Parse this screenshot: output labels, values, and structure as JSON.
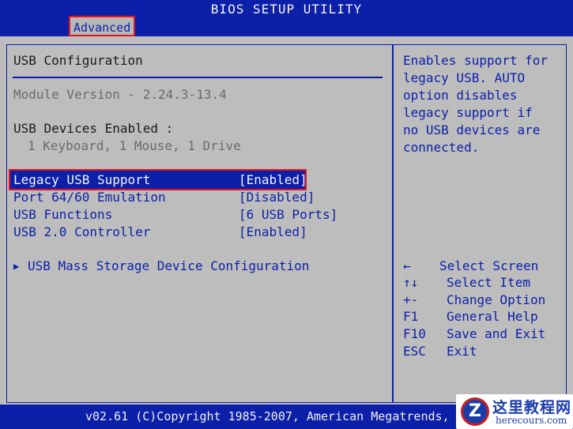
{
  "window": {
    "title": "BIOS SETUP UTILITY"
  },
  "tabs": [
    {
      "label": "Advanced",
      "active": true
    }
  ],
  "section": {
    "title": "USB Configuration"
  },
  "module": {
    "text": "Module Version - 2.24.3-13.4"
  },
  "devices": {
    "heading": "USB Devices Enabled :",
    "list": "1 Keyboard, 1 Mouse, 1 Drive"
  },
  "settings": [
    {
      "label": "Legacy USB Support",
      "value": "[Enabled]"
    },
    {
      "label": "Port 64/60 Emulation",
      "value": "[Disabled]"
    },
    {
      "label": "USB Functions",
      "value": "[6 USB Ports]"
    },
    {
      "label": "USB 2.0 Controller",
      "value": "[Enabled]"
    }
  ],
  "submenu": {
    "arrow": "▶",
    "label": "USB Mass Storage Device Configuration"
  },
  "help": {
    "text": "Enables support for legacy USB. AUTO option disables legacy support if no USB devices are connected."
  },
  "keys": [
    {
      "key": "←",
      "action": "Select Screen"
    },
    {
      "key": "↑↓",
      "action": "Select Item"
    },
    {
      "key": "+-",
      "action": "Change Option"
    },
    {
      "key": "F1",
      "action": "General Help"
    },
    {
      "key": "F10",
      "action": "Save and Exit"
    },
    {
      "key": "ESC",
      "action": "Exit"
    }
  ],
  "footer": {
    "text": "v02.61 (C)Copyright 1985-2007, American Megatrends,"
  },
  "watermark": {
    "cn": "这里教程网",
    "url": "herecours.com",
    "logo": "Z"
  },
  "colors": {
    "blue": "#0b1fa8",
    "panel": "#bdbdbd",
    "highlight_border": "#e2161f"
  }
}
